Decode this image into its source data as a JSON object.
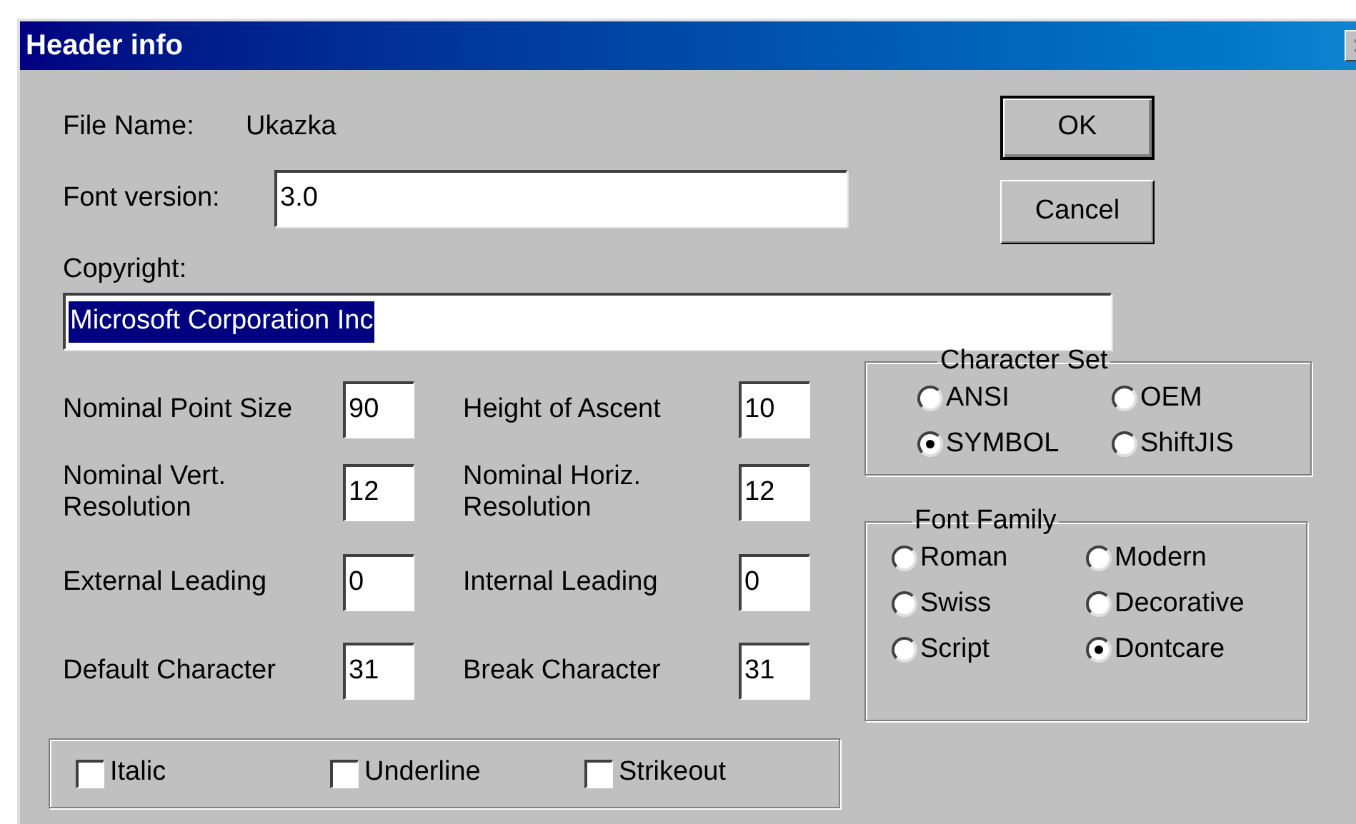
{
  "window": {
    "title": "Header info"
  },
  "file_name": {
    "label": "File Name:",
    "value": "Ukazka"
  },
  "font_version": {
    "label": "Font version:",
    "value": "3.0"
  },
  "copyright": {
    "label": "Copyright:",
    "value": "Microsoft Corporation Inc",
    "selected": true
  },
  "buttons": [
    {
      "label": "OK",
      "default": true
    },
    {
      "label": "Cancel",
      "default": false
    }
  ],
  "metrics": [
    {
      "label": "Nominal Point Size",
      "value": "90"
    },
    {
      "label": "Height of Ascent",
      "value": "10"
    },
    {
      "label": "Nominal Vert. Resolution",
      "value": "12"
    },
    {
      "label": "Nominal Horiz. Resolution",
      "value": "12"
    },
    {
      "label": "External Leading",
      "value": "0"
    },
    {
      "label": "Internal Leading",
      "value": "0"
    },
    {
      "label": "Default Character",
      "value": "31"
    },
    {
      "label": "Break Character",
      "value": "31"
    }
  ],
  "styles": [
    {
      "label": "Italic",
      "checked": false
    },
    {
      "label": "Underline",
      "checked": false
    },
    {
      "label": "Strikeout",
      "checked": false
    }
  ],
  "character_set": {
    "title": "Character Set",
    "options": [
      {
        "label": "ANSI",
        "selected": false
      },
      {
        "label": "OEM",
        "selected": false
      },
      {
        "label": "SYMBOL",
        "selected": true
      },
      {
        "label": "ShiftJIS",
        "selected": false
      }
    ]
  },
  "font_family": {
    "title": "Font Family",
    "options": [
      {
        "label": "Roman",
        "selected": false
      },
      {
        "label": "Modern",
        "selected": false
      },
      {
        "label": "Swiss",
        "selected": false
      },
      {
        "label": "Decorative",
        "selected": false
      },
      {
        "label": "Script",
        "selected": false
      },
      {
        "label": "Dontcare",
        "selected": true
      }
    ]
  }
}
